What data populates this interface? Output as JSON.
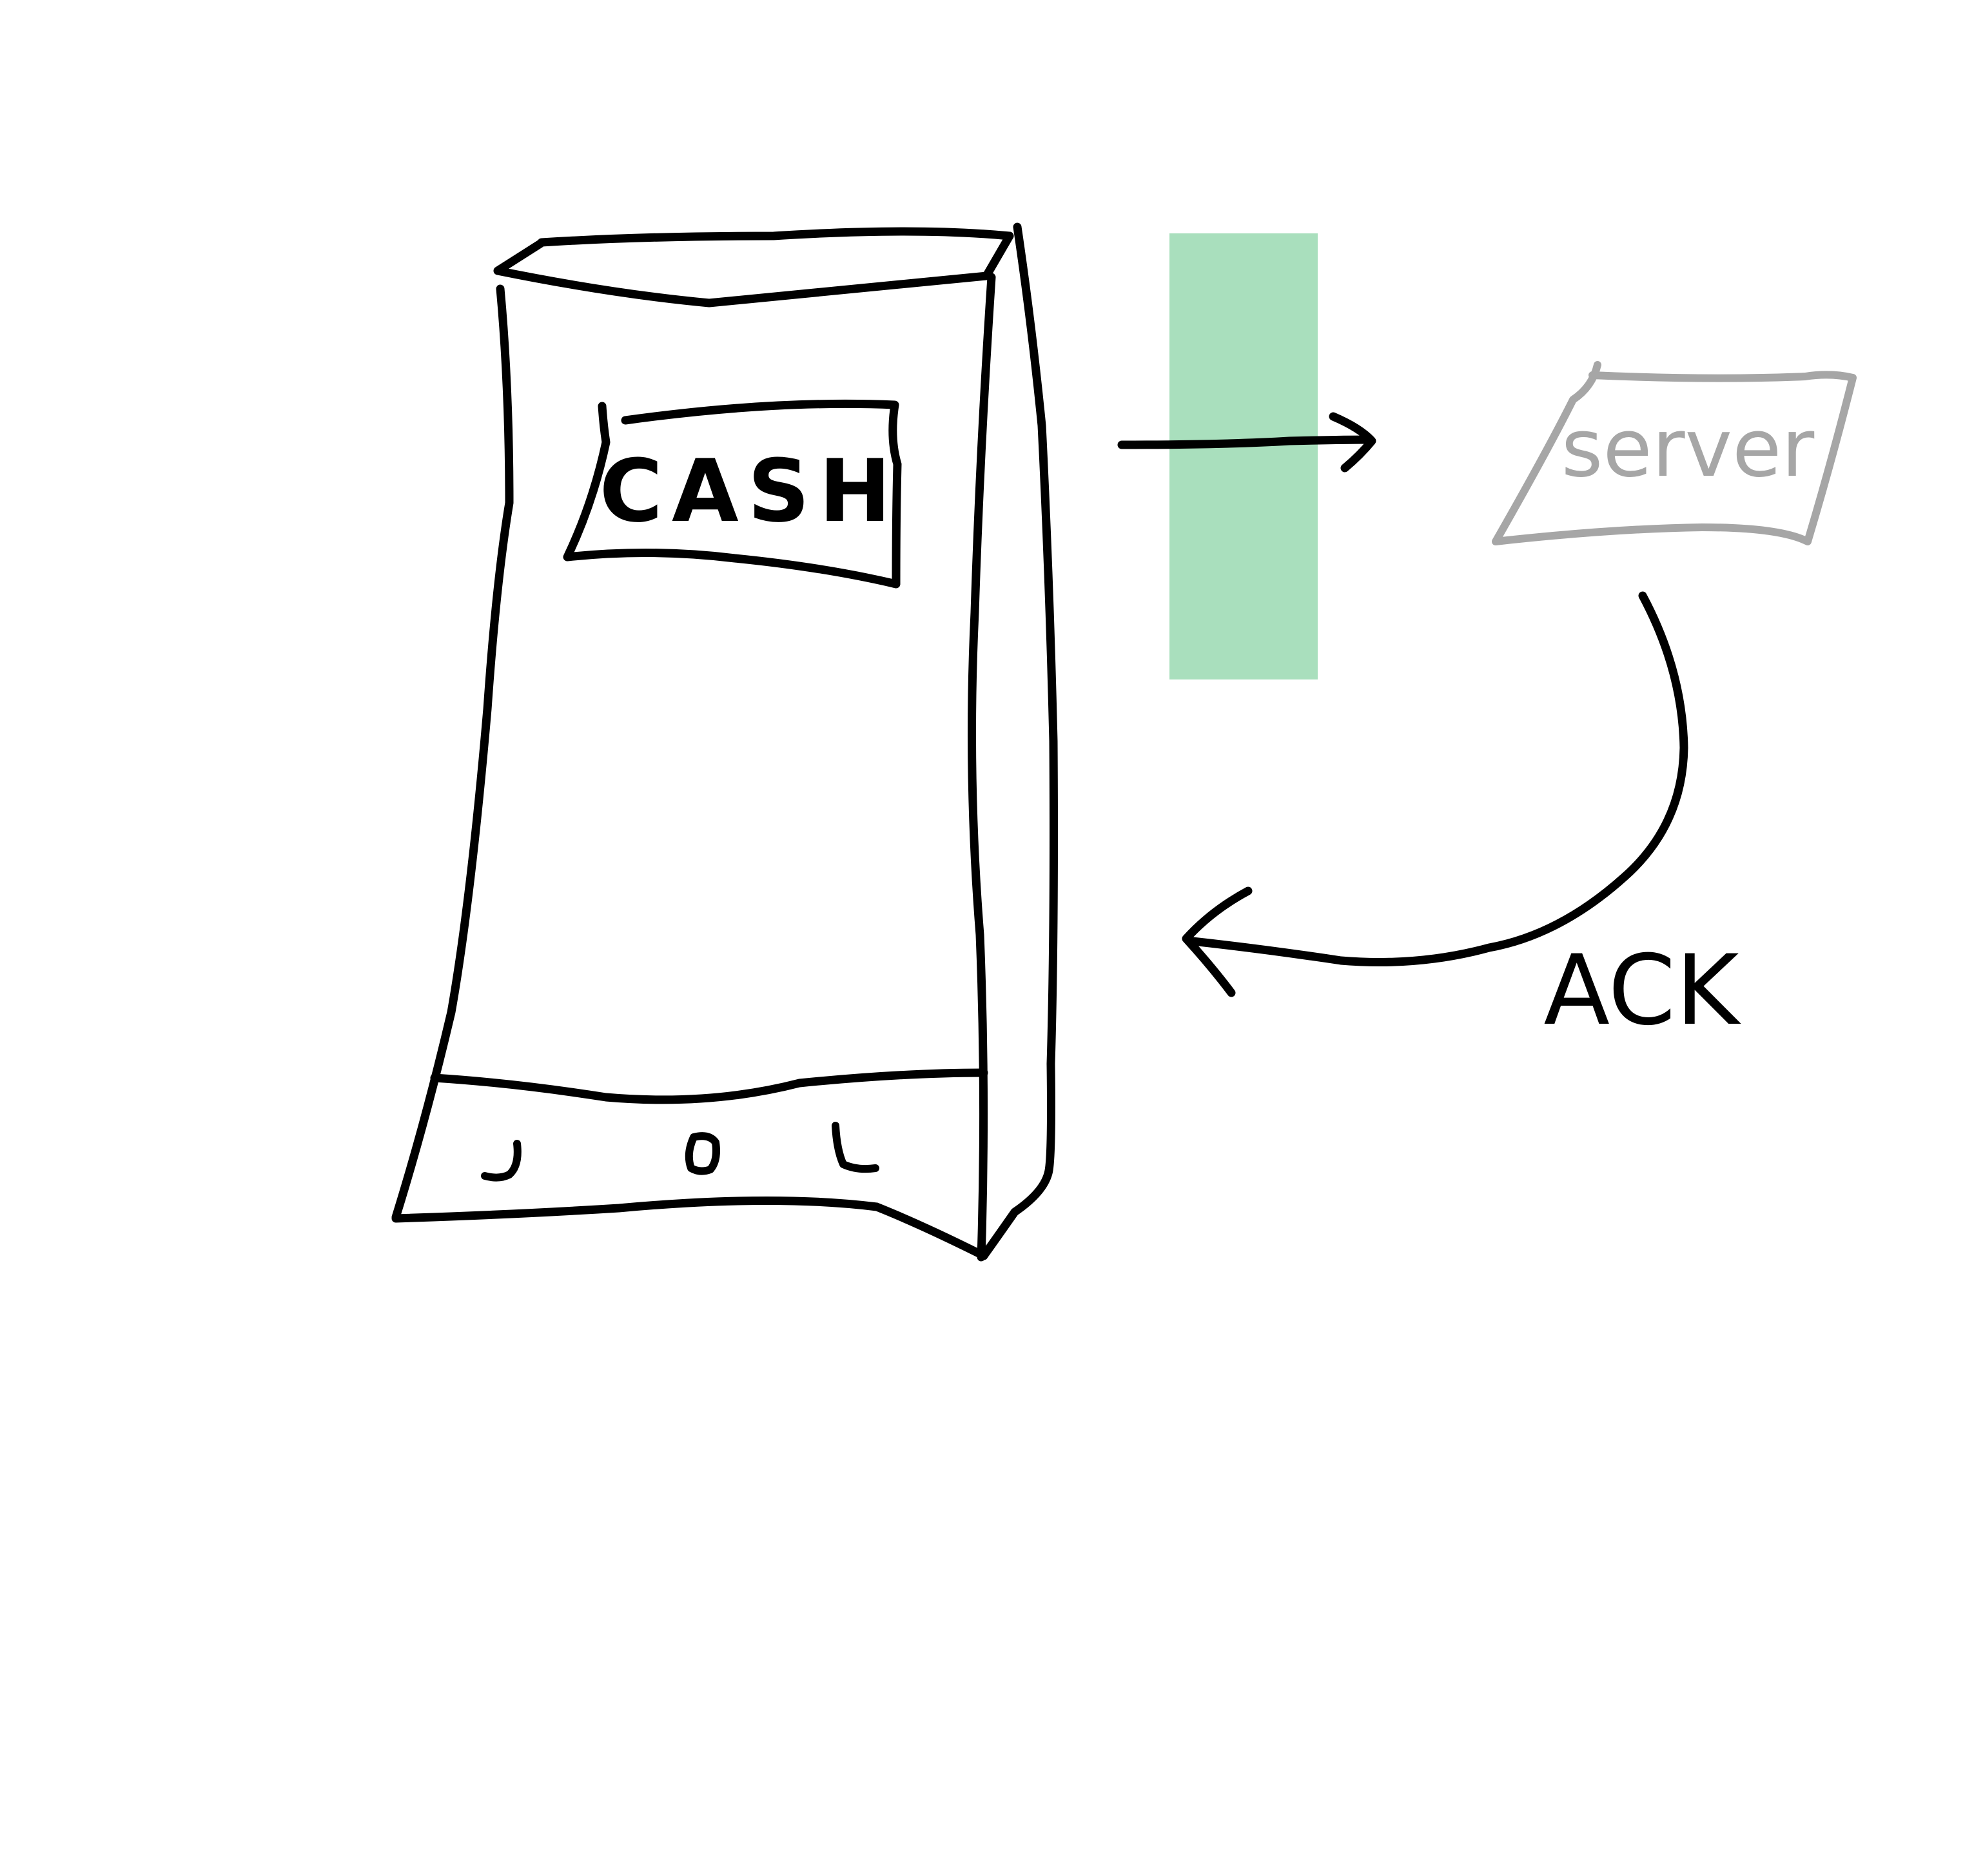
{
  "colors": {
    "background": "#ffffff",
    "ink": "#000000",
    "server_ink": "#a6a6a6",
    "highlight": "#a9dfbd"
  },
  "device": {
    "label": "CASH"
  },
  "server": {
    "label": "server"
  },
  "response": {
    "label": "ACK"
  }
}
